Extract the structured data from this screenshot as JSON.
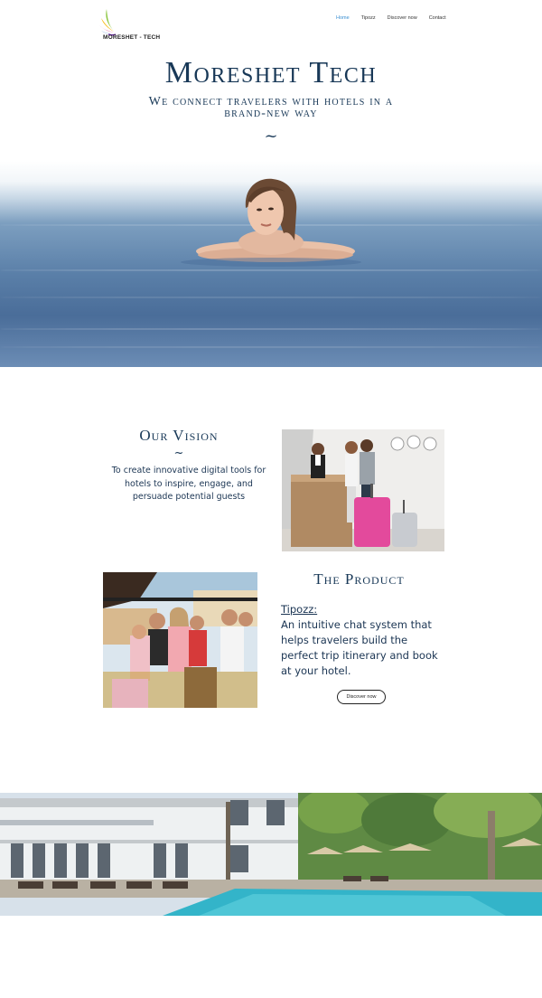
{
  "brand": {
    "logo_text": "MORESHET - TECH",
    "accent_color": "#3a8fd1",
    "text_color": "#183857"
  },
  "nav": {
    "items": [
      {
        "label": "Home",
        "active": true
      },
      {
        "label": "Tipozz",
        "active": false
      },
      {
        "label": "Discover now",
        "active": false
      },
      {
        "label": "Contact",
        "active": false
      }
    ]
  },
  "hero": {
    "title": "Moreshet Tech",
    "subtitle": "We connect travelers with hotels in a brand-new way",
    "divider": "~"
  },
  "vision": {
    "title": "Our Vision",
    "divider": "~",
    "text": "To create innovative digital tools for hotels to inspire, engage, and persuade potential guests"
  },
  "product": {
    "title": "The Product",
    "name": "Tipozz:",
    "description": "An intuitive chat system that helps travelers build the perfect trip itinerary and book at your hotel.",
    "cta_label": "Discover now"
  }
}
